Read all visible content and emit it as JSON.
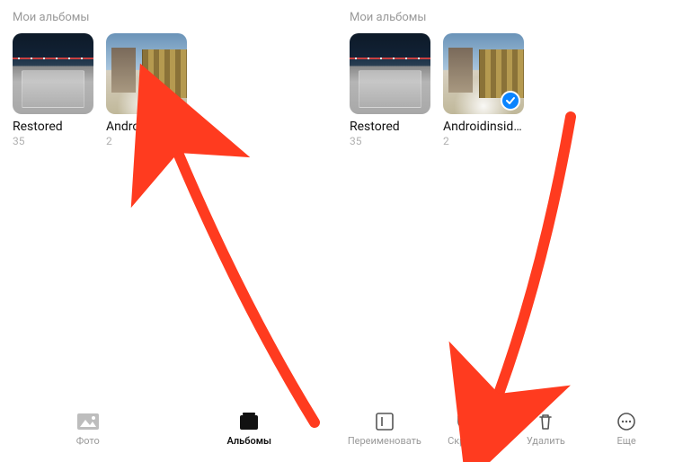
{
  "left": {
    "section_title": "Мои альбомы",
    "albums": [
      {
        "name": "Restored",
        "count": "35"
      },
      {
        "name": "Androidinsider",
        "count": "2"
      }
    ],
    "tabs": {
      "photo": "Фото",
      "albums": "Альбомы"
    }
  },
  "right": {
    "section_title": "Мои альбомы",
    "albums": [
      {
        "name": "Restored",
        "count": "35"
      },
      {
        "name": "Androidinsider",
        "count": "2",
        "selected": true
      }
    ],
    "actions": {
      "rename": "Переименовать",
      "hide": "Скрыть",
      "delete": "Удалить",
      "more": "Еще"
    }
  },
  "annotation": {
    "color": "#ff3b1f"
  }
}
